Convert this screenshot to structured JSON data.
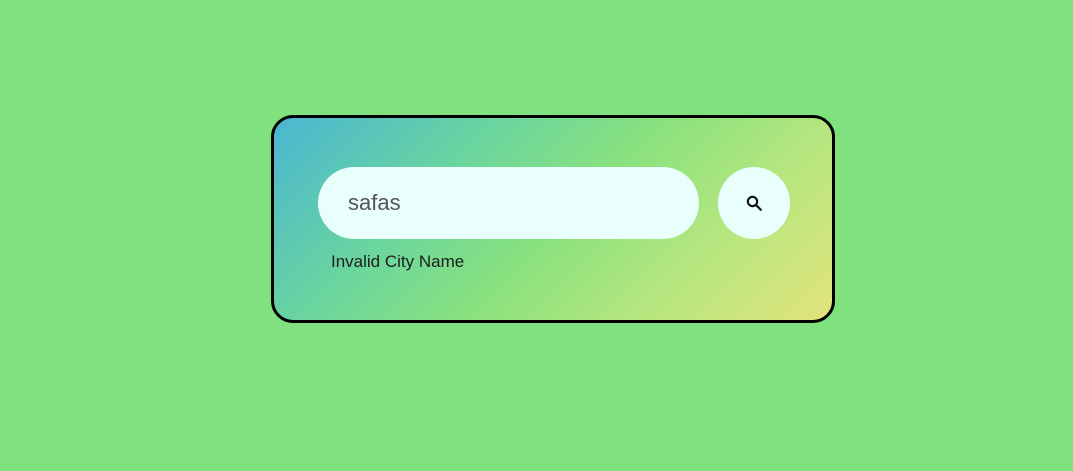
{
  "search": {
    "value": "safas",
    "placeholder": "",
    "button_icon": "search-icon"
  },
  "error": {
    "message": "Invalid City Name"
  },
  "colors": {
    "page_background": "#80e27e",
    "card_border": "#000000",
    "gradient_start": "#4ab6d3",
    "gradient_end": "#e2e47c",
    "input_background": "#e8fffb"
  }
}
